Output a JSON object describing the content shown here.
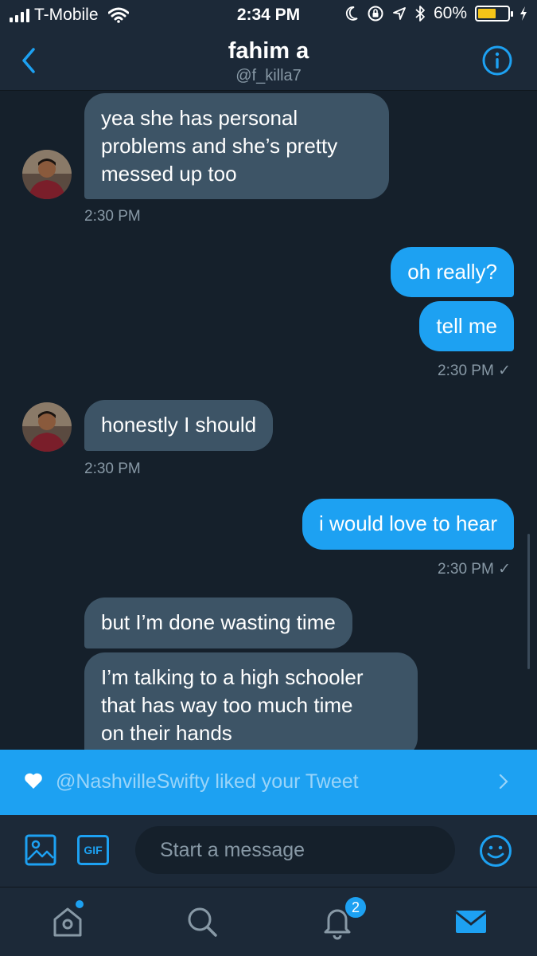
{
  "status_bar": {
    "carrier": "T-Mobile",
    "time": "2:34 PM",
    "battery": "60%",
    "battery_level": 0.6
  },
  "header": {
    "name": "fahim a",
    "handle": "@f_killa7"
  },
  "messages": [
    {
      "direction": "incoming",
      "text_lines": [
        "yea she has personal",
        "problems and she’s pretty",
        "messed up too"
      ]
    },
    {
      "direction": "incoming_timestamp",
      "text": "2:30 PM"
    },
    {
      "direction": "outgoing",
      "text": "oh really?"
    },
    {
      "direction": "outgoing",
      "text": "tell me"
    },
    {
      "direction": "outgoing_timestamp",
      "text": "2:30 PM ✓"
    },
    {
      "direction": "incoming",
      "text": "honestly I should"
    },
    {
      "direction": "incoming_timestamp",
      "text": "2:30 PM"
    },
    {
      "direction": "outgoing",
      "text": "i would love to hear"
    },
    {
      "direction": "outgoing_timestamp",
      "text": "2:30 PM ✓"
    },
    {
      "direction": "incoming",
      "text": "but I’m done wasting time"
    },
    {
      "direction": "incoming",
      "text_lines": [
        "I’m talking to a high schooler",
        "that has way too much time",
        "on their hands"
      ]
    }
  ],
  "notification": {
    "text": "@NashvilleSwifty liked your Tweet",
    "icon": "heart-icon"
  },
  "composer": {
    "placeholder": "Start a message",
    "gif_label": "GIF"
  },
  "tabbar": {
    "notifications_badge": "2",
    "icons": [
      "home-icon",
      "search-icon",
      "notifications-icon",
      "messages-icon"
    ]
  },
  "colors": {
    "background": "#15202b",
    "bar": "#1c2938",
    "accent": "#1da1f2",
    "incoming_bubble": "#3d5466",
    "secondary_text": "#8899a6",
    "battery": "#f5c518"
  }
}
